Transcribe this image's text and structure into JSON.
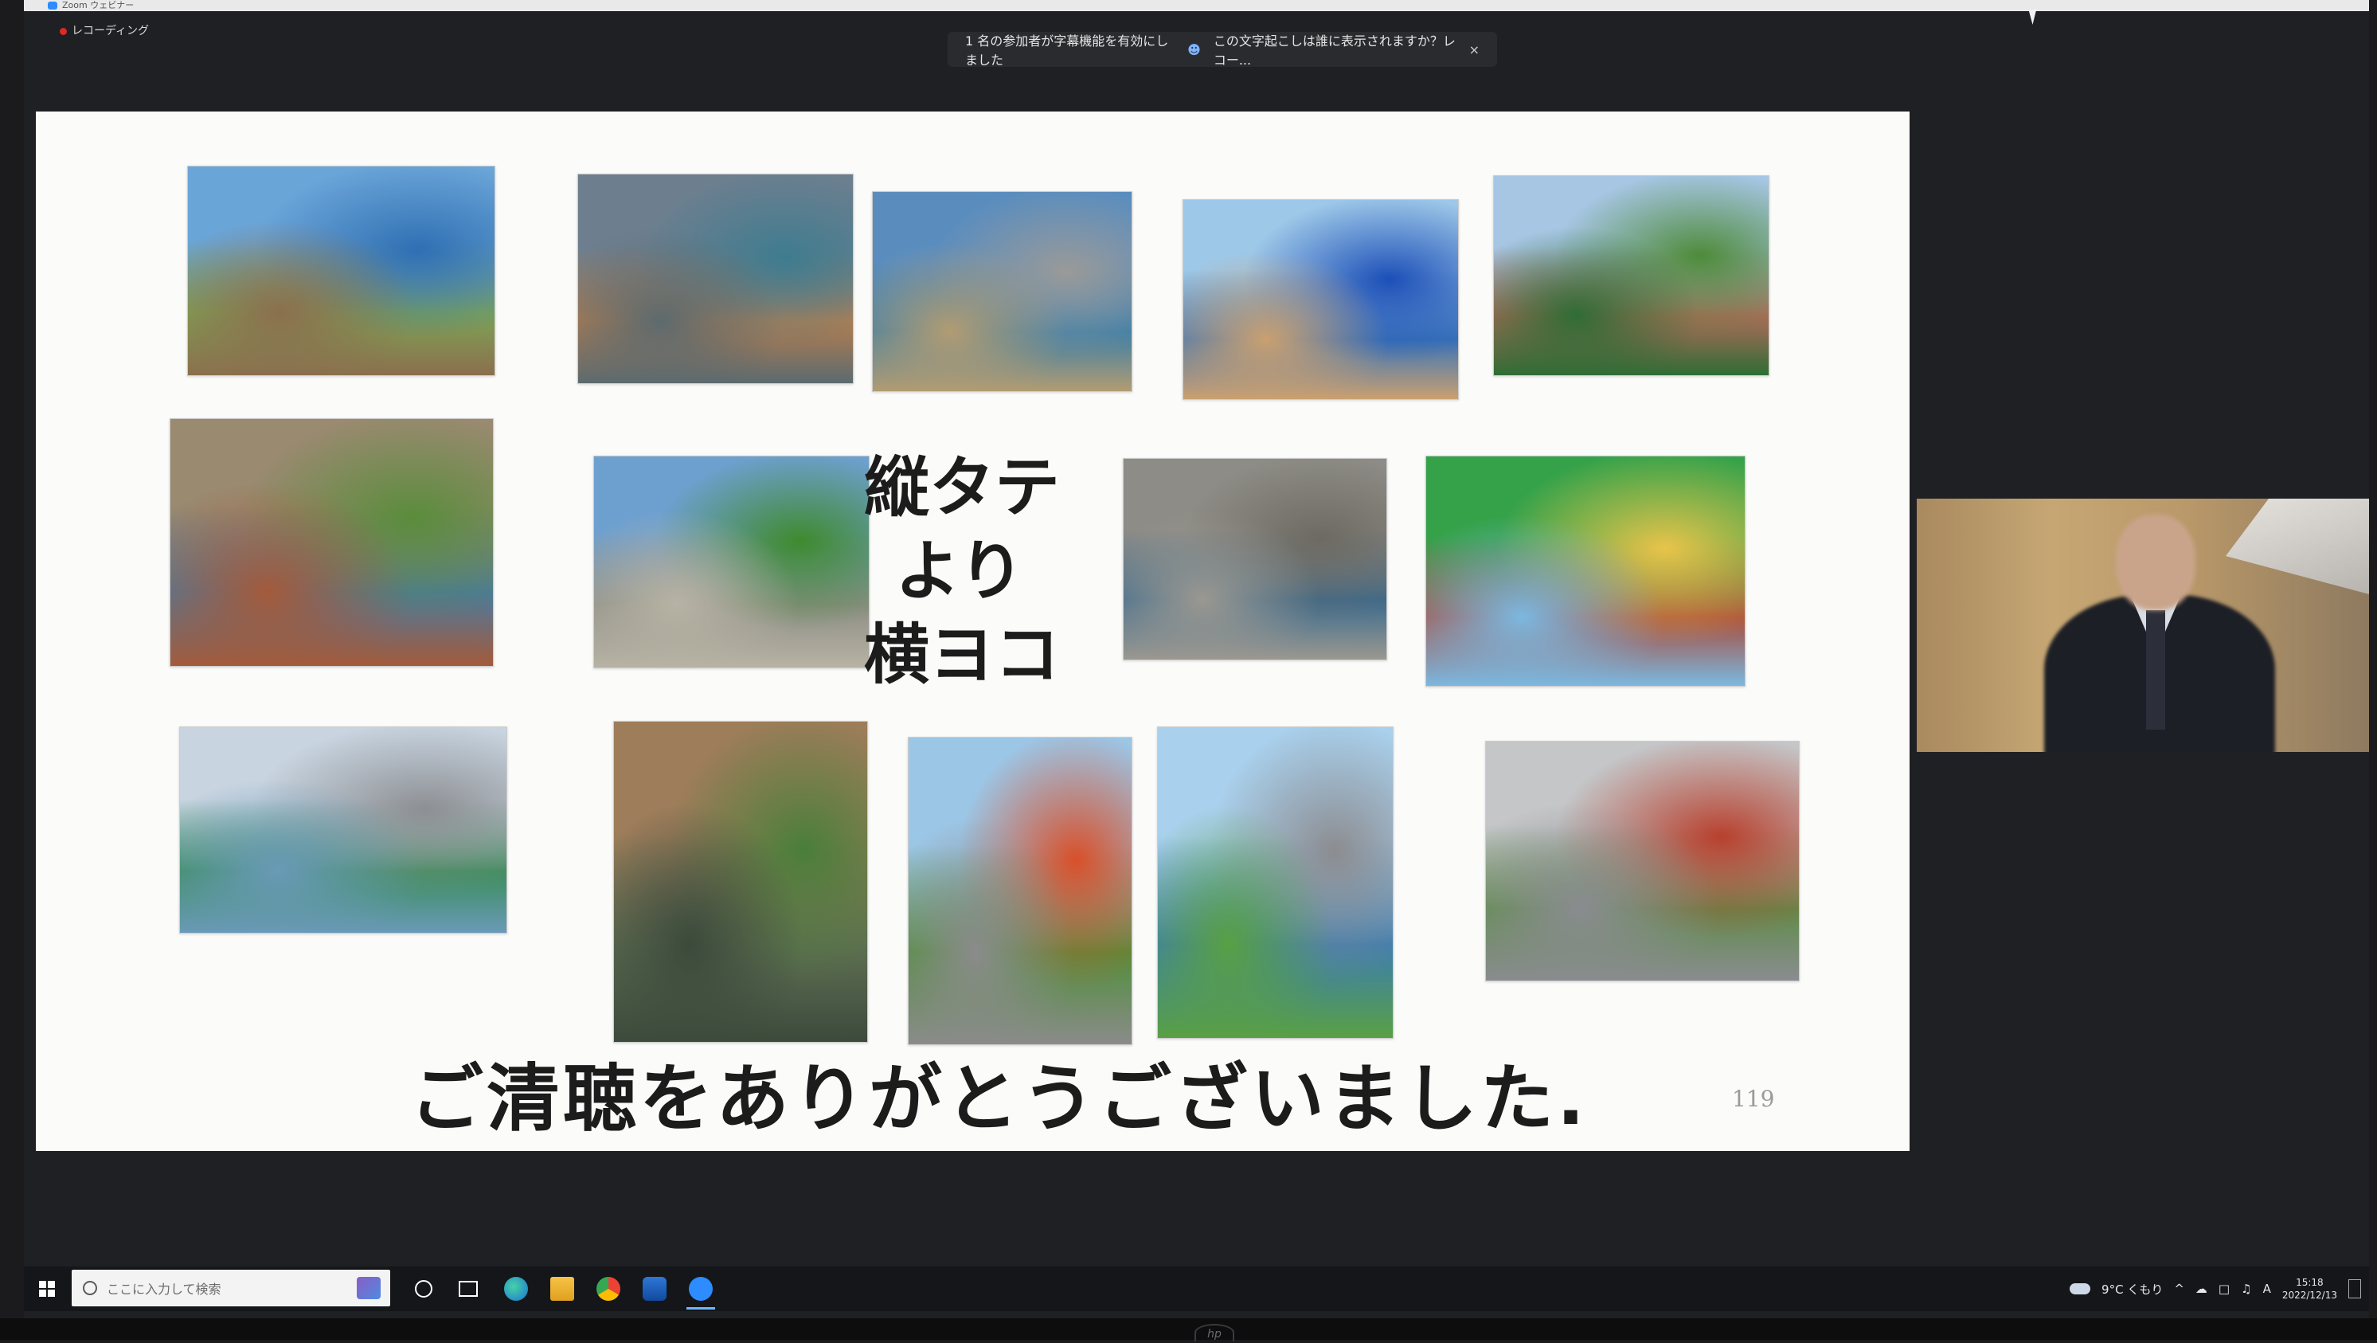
{
  "window": {
    "title": "Zoom ウェビナー",
    "recording_label": "レコーディング"
  },
  "caption_banner": {
    "message": "1 名の参加者が字幕機能を有効にしました",
    "question": "この文字起こしは誰に表示されますか？レコー...",
    "close": "×"
  },
  "slide": {
    "center_lines": [
      "縦タテ",
      "より",
      "横ヨコ"
    ],
    "thanks": "ご清聴をありがとうございました.",
    "page_number": "119",
    "paintings": [
      {
        "name": "harbor-bridge-painting",
        "colors": [
          "#6aa5d8",
          "#2f6fb3",
          "#7ea454",
          "#8b6f4e"
        ]
      },
      {
        "name": "river-arch-bridge-painting",
        "colors": [
          "#6d7f8f",
          "#3e7c8f",
          "#b57e4f",
          "#5c6a6f"
        ]
      },
      {
        "name": "rainbow-bridge-painting",
        "colors": [
          "#5a8dbe",
          "#9a9a98",
          "#3b7ea7",
          "#b29c72"
        ]
      },
      {
        "name": "blue-steel-bridge-painting",
        "colors": [
          "#9ec8e8",
          "#1c4fb8",
          "#3a74b8",
          "#caa070"
        ]
      },
      {
        "name": "city-moat-painting",
        "colors": [
          "#a7c6e4",
          "#4e8b3a",
          "#b06a5a",
          "#2f6d35"
        ]
      },
      {
        "name": "stone-arch-viaduct-painting",
        "colors": [
          "#9a8a70",
          "#5a8c3c",
          "#4a7aa0",
          "#a45a3a"
        ]
      },
      {
        "name": "palace-stone-bridge-painting",
        "colors": [
          "#6ea0cf",
          "#3f8a2e",
          "#8e8e86",
          "#b7b3a4"
        ]
      },
      {
        "name": "nihonbashi-bridge-painting",
        "colors": [
          "#8e8c86",
          "#6d6a62",
          "#3a6a8e",
          "#9b9890"
        ]
      },
      {
        "name": "green-rail-bridge-painting",
        "colors": [
          "#35a24a",
          "#e8c44a",
          "#a84a3a",
          "#7bb8e0"
        ]
      },
      {
        "name": "steel-truss-bridge-painting",
        "colors": [
          "#c8d4e0",
          "#8d8f93",
          "#3a8d5a",
          "#6a9ab8"
        ]
      },
      {
        "name": "tokyo-station-painting",
        "colors": [
          "#9d7d5a",
          "#4a7e3a",
          "#5f6e52",
          "#3c4a3c"
        ]
      },
      {
        "name": "red-arch-bridge-painting",
        "colors": [
          "#9cc6e6",
          "#d8502a",
          "#4f8f3a",
          "#8b8b8b"
        ]
      },
      {
        "name": "landmark-tower-painting",
        "colors": [
          "#a9d0ec",
          "#8c8c90",
          "#3b7db0",
          "#59a044"
        ]
      },
      {
        "name": "elevated-road-painting",
        "colors": [
          "#c4c6c8",
          "#b8402e",
          "#5f8d4a",
          "#8a8c90"
        ]
      }
    ]
  },
  "taskbar": {
    "search_placeholder": "ここに入力して検索",
    "apps": [
      "task-view",
      "edge",
      "file-explorer",
      "chrome",
      "outlook",
      "zoom"
    ],
    "weather": "9°C くもり",
    "ime": "A",
    "time": "15:18",
    "date": "2022/12/13"
  }
}
